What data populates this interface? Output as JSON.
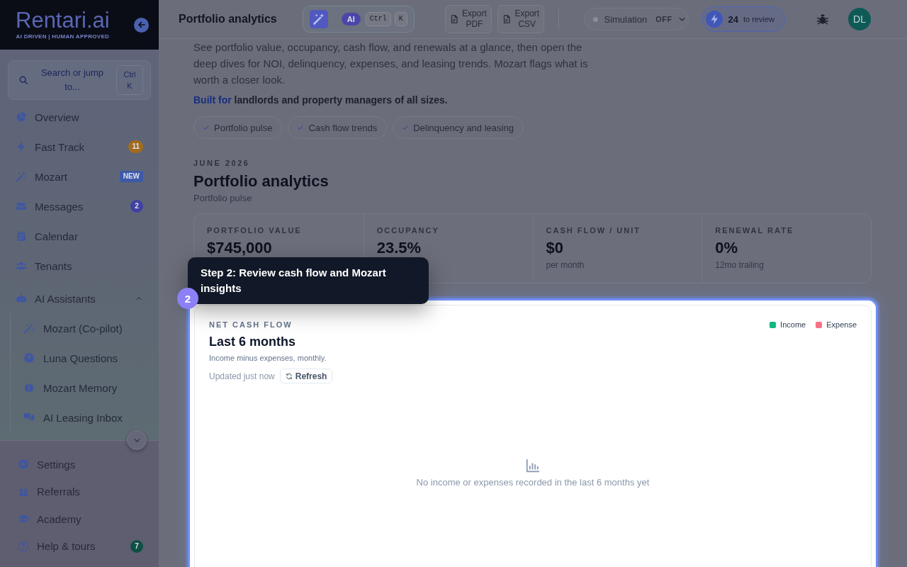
{
  "sidebar": {
    "logo": {
      "wordmark": "Rentari.ai",
      "tagline": "AI DRIVEN | HUMAN APPROVED"
    },
    "search": {
      "placeholder": "Search or jump to...",
      "shortcut": "Ctrl K"
    },
    "items": [
      {
        "label": "Overview",
        "selected": false
      },
      {
        "label": "Fast Track",
        "selected": false,
        "badge": {
          "text": "11",
          "kind": "count",
          "color": "#a36b1d"
        }
      },
      {
        "label": "Mozart",
        "selected": false,
        "badge": {
          "text": "NEW",
          "kind": "tag",
          "color": "#3d59a8"
        }
      },
      {
        "label": "Messages",
        "selected": false,
        "badge": {
          "text": "2",
          "kind": "count",
          "color": "#4041a3"
        }
      },
      {
        "label": "Calendar",
        "selected": false
      },
      {
        "label": "Tenants",
        "selected": false
      },
      {
        "label": "AI Assistants",
        "selected": false,
        "expanded": true,
        "children": [
          {
            "label": "Mozart (Co-pilot)",
            "selected": false
          },
          {
            "label": "Luna Questions",
            "selected": false
          },
          {
            "label": "Mozart Memory",
            "selected": false
          },
          {
            "label": "AI Leasing Inbox",
            "selected": false
          }
        ]
      }
    ],
    "footer_items": [
      {
        "label": "Settings",
        "selected": false
      },
      {
        "label": "Referrals",
        "selected": false
      },
      {
        "label": "Academy",
        "selected": false
      },
      {
        "label": "Help & tours",
        "selected": false,
        "badge": {
          "text": "7",
          "kind": "count",
          "color": "#0f4f46"
        }
      }
    ]
  },
  "topbar": {
    "title": "Portfolio analytics",
    "ai_command": {
      "badge": "AI",
      "keys": [
        "Ctrl",
        "K"
      ]
    },
    "exports": [
      "Export PDF",
      "Export CSV"
    ],
    "simulation": {
      "label": "Simulation",
      "state": "OFF",
      "on": false
    },
    "review": {
      "count": "24",
      "label": "to review"
    },
    "avatar": {
      "initials": "DL"
    }
  },
  "intro": {
    "text": "See portfolio value, occupancy, cash flow, and renewals at a glance, then open the deep dives for NOI, delinquency, expenses, and leasing trends. Mozart flags what is worth a closer look.",
    "built_for": "**Built for** landlords and property managers of all sizes.",
    "chips": [
      "Portfolio pulse",
      "Cash flow trends",
      "Delinquency and leasing"
    ]
  },
  "section": {
    "period": "JUNE 2026",
    "heading": "Portfolio analytics",
    "subheading": "Portfolio pulse"
  },
  "stats": [
    {
      "label": "PORTFOLIO VALUE",
      "value": "$745,000"
    },
    {
      "label": "OCCUPANCY",
      "value": "23.5%"
    },
    {
      "label": "CASH FLOW / UNIT",
      "value": "$0",
      "caption": "per month"
    },
    {
      "label": "RENEWAL RATE",
      "value": "0%",
      "caption": "12mo trailing"
    }
  ],
  "chart_card": {
    "label": "NET CASH FLOW",
    "title": "Last 6 months",
    "subtitle": "Income minus expenses, monthly.",
    "updated": "Updated just now",
    "refresh": "Refresh",
    "legend": [
      {
        "name": "Income",
        "color": "#10b981"
      },
      {
        "name": "Expense",
        "color": "#f87186"
      }
    ],
    "empty_message": "No income or expenses recorded in the last 6 months yet"
  },
  "tour": {
    "step": "2",
    "text": "Step 2: Review cash flow and Mozart insights"
  }
}
